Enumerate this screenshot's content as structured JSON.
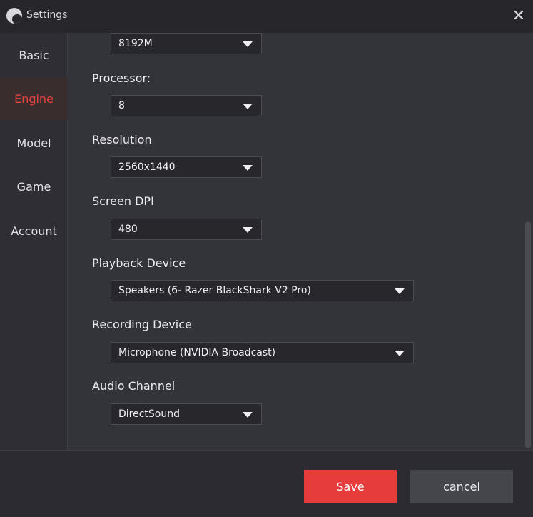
{
  "window": {
    "title": "Settings",
    "close_glyph": "✕"
  },
  "sidebar": {
    "items": [
      {
        "label": "Basic",
        "active": false
      },
      {
        "label": "Engine",
        "active": true
      },
      {
        "label": "Model",
        "active": false
      },
      {
        "label": "Game",
        "active": false
      },
      {
        "label": "Account",
        "active": false
      }
    ]
  },
  "engine": {
    "memory": {
      "value": "8192M"
    },
    "processor": {
      "label": "Processor:",
      "value": "8"
    },
    "resolution": {
      "label": "Resolution",
      "value": "2560x1440"
    },
    "screen_dpi": {
      "label": "Screen DPI",
      "value": "480"
    },
    "playback_device": {
      "label": "Playback Device",
      "value": "Speakers (6- Razer BlackShark V2 Pro)"
    },
    "recording_device": {
      "label": "Recording Device",
      "value": "Microphone (NVIDIA Broadcast)"
    },
    "audio_channel": {
      "label": "Audio Channel",
      "value": "DirectSound"
    }
  },
  "footer": {
    "save_label": "Save",
    "cancel_label": "cancel"
  },
  "colors": {
    "accent": "#e63c3c",
    "background": "#33333a",
    "titlebar": "#26262b"
  }
}
